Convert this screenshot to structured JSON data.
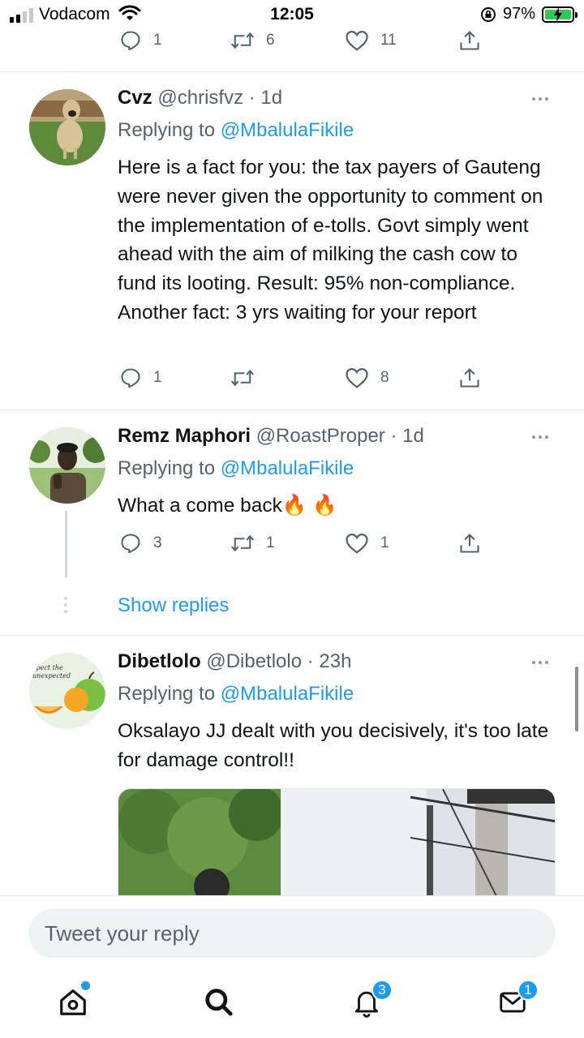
{
  "status_bar": {
    "carrier": "Vodacom",
    "time": "12:05",
    "battery_percent": "97%"
  },
  "previous_tweet_actions": {
    "replies": "1",
    "retweets": "6",
    "likes": "11"
  },
  "tweets": [
    {
      "name": "Cvz",
      "meta": "@chrisfvz · 1d",
      "replying_prefix": "Replying to ",
      "replying_handle": "@MbalulaFikile",
      "text": "Here is a fact for you: the tax payers of Gauteng were never given the opportunity to comment on the implementation of e-tolls. Govt simply went ahead with the aim of milking the cash cow to fund its looting. Result: 95% non-compliance. Another fact: 3 yrs waiting for your report",
      "replies": "1",
      "retweets": "",
      "likes": "8"
    },
    {
      "name": "Remz Maphori",
      "meta": "@RoastProper · 1d",
      "replying_prefix": "Replying to ",
      "replying_handle": "@MbalulaFikile",
      "text": "What a come back🔥 🔥",
      "replies": "3",
      "retweets": "1",
      "likes": "1"
    },
    {
      "name": "Dibetlolo",
      "meta": "@Dibetlolo · 23h",
      "replying_prefix": "Replying to ",
      "replying_handle": "@MbalulaFikile",
      "text": "Oksalayo JJ dealt with you decisively, it's too late for damage control!!",
      "avatar_caption": "xpect the unexpected"
    }
  ],
  "show_replies_label": "Show replies",
  "reply_placeholder": "Tweet your reply",
  "tabbar": {
    "notifications_badge": "3",
    "messages_badge": "1"
  },
  "colors": {
    "accent": "#1d9bf0",
    "text": "#0f1419",
    "muted": "#536471"
  }
}
